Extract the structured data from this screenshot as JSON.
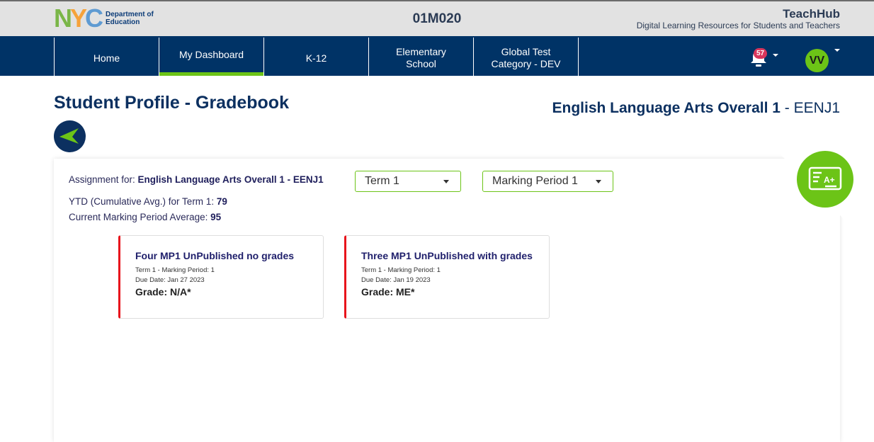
{
  "header": {
    "logo": {
      "letters": [
        "N",
        "Y",
        "C"
      ],
      "line1": "Department of",
      "line2": "Education"
    },
    "school_code": "01M020",
    "brand_title": "TeachHub",
    "brand_subtitle": "Digital Learning Resources for Students and Teachers"
  },
  "nav": {
    "items": [
      {
        "label": "Home",
        "active": false
      },
      {
        "label": "My Dashboard",
        "active": true
      },
      {
        "label": "K-12",
        "active": false
      },
      {
        "label": "Elementary\nSchool",
        "active": false
      },
      {
        "label": "Global Test\nCategory - DEV",
        "active": false
      }
    ],
    "notifications": {
      "icon": "bell-icon",
      "count": "57"
    },
    "user": {
      "initials": "VV"
    }
  },
  "page": {
    "title": "Student Profile - Gradebook",
    "course_name": "English Language Arts Overall 1",
    "course_separator": " - ",
    "course_code": "EENJ1",
    "back_icon": "arrow-left-icon"
  },
  "panel": {
    "assignment_label": "Assignment for: ",
    "assignment_value": "English Language Arts Overall 1 - EENJ1",
    "ytd_label": "YTD (Cumulative Avg.) for Term 1: ",
    "ytd_value": "79",
    "mp_avg_label": "Current Marking Period Average: ",
    "mp_avg_value": "95",
    "term_select": "Term 1",
    "marking_period_select": "Marking Period 1",
    "badge_icon": "gradebook-a-plus-icon"
  },
  "assignments": [
    {
      "title": "Four MP1 UnPublished no grades",
      "term_line": "Term 1 - Marking Period: 1",
      "due_line": "Due Date: Jan 27 2023",
      "grade_line": "Grade: N/A*"
    },
    {
      "title": "Three MP1 UnPublished with grades",
      "term_line": "Term 1 - Marking Period: 1",
      "due_line": "Due Date: Jan 19 2023",
      "grade_line": "Grade: ME*"
    }
  ],
  "colors": {
    "navy": "#003366",
    "accent_green": "#6cc417",
    "card_accent_red": "#e8141c",
    "notification_badge": "#d9365c"
  }
}
